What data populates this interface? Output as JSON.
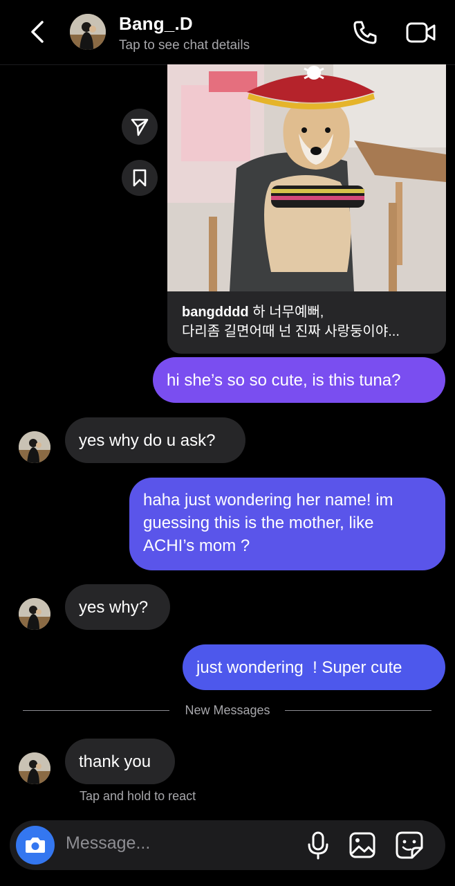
{
  "header": {
    "name": "Bang_.D",
    "subtitle": "Tap to see chat details",
    "icons": [
      "back-icon",
      "phone-icon",
      "video-camera-icon"
    ]
  },
  "post": {
    "username": "bangdddd",
    "caption_line1": "하 너무예뻐,",
    "caption_line2": "다리좀 길면어때 넌 진짜 사랑둥이야...",
    "image_description_icon": "dog-photo"
  },
  "messages": [
    {
      "from": "me",
      "text": "hi she’s so so cute, is this tuna?"
    },
    {
      "from": "them",
      "text": "yes why do u ask?"
    },
    {
      "from": "me",
      "line1": "haha just wondering her name! im",
      "line2": "guessing this is the mother, like",
      "line3": "ACHI’s mom ?"
    },
    {
      "from": "them",
      "text": "yes why?"
    },
    {
      "from": "me",
      "text": "just wondering  ! Super cute"
    },
    {
      "from": "them",
      "text": "thank you"
    }
  ],
  "divider_label": "New Messages",
  "react_hint": "Tap and hold to react",
  "composer": {
    "placeholder": "Message...",
    "icons": [
      "camera-icon",
      "microphone-icon",
      "image-icon",
      "sticker-icon"
    ]
  },
  "colors": {
    "background": "#000000",
    "incoming_bubble": "#262628",
    "outgoing_gradient_top": "#7a4ef0",
    "outgoing_gradient_bottom": "#4d58ec",
    "camera_button": "#3477f0"
  }
}
